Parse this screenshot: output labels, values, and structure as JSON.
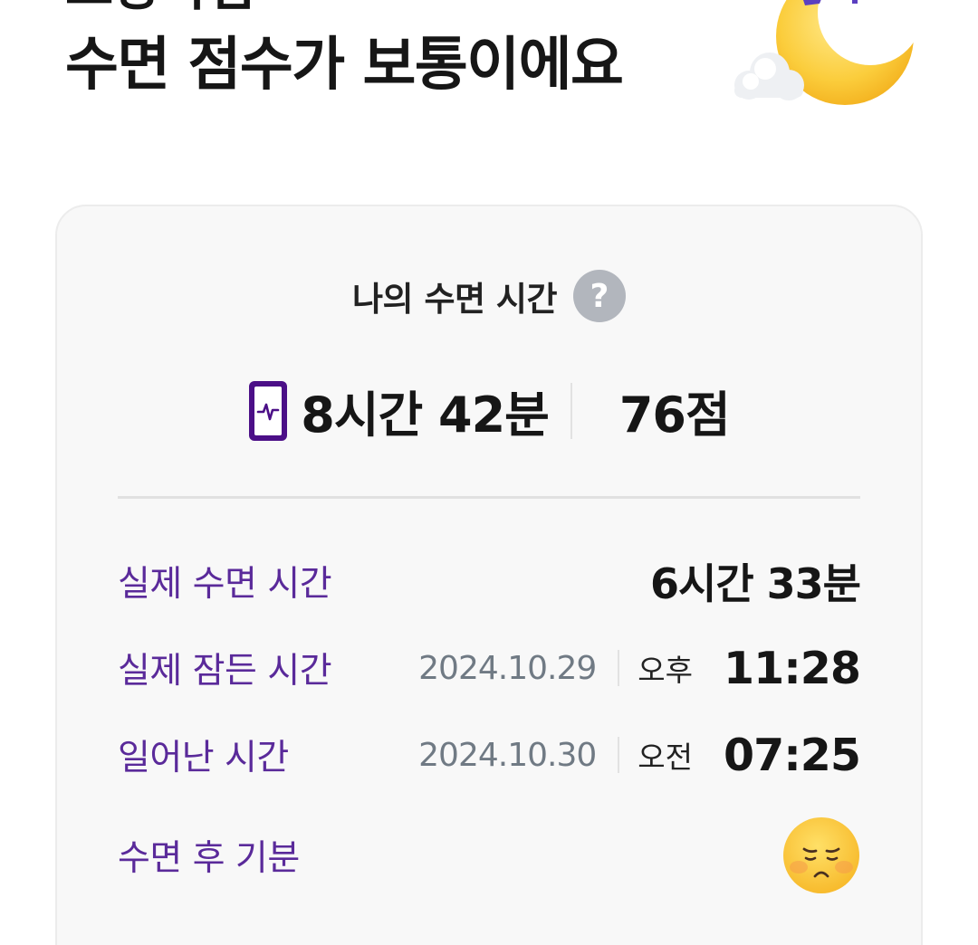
{
  "header": {
    "line1": "고양파입",
    "line2": "수면 점수가 보통이에요"
  },
  "card": {
    "title": "나의 수면 시간",
    "help_icon": "question-circle-icon",
    "help_glyph": "?",
    "total_time": "8시간 42분",
    "score": "76점",
    "rows": [
      {
        "label": "실제 수면 시간",
        "value": "6시간 33분"
      },
      {
        "label": "실제 잠든 시간",
        "date": "2024.10.29",
        "ampm": "오후",
        "time": "11:28"
      },
      {
        "label": "일어난 시간",
        "date": "2024.10.30",
        "ampm": "오전",
        "time": "07:25"
      },
      {
        "label": "수면 후 기분",
        "mood_icon": "tired-face-emoji-icon"
      }
    ]
  },
  "colors": {
    "accent_purple": "#5a2a9a",
    "device_icon_purple": "#4b0f87",
    "help_gray": "#b2b6bd",
    "card_bg": "#f8f8f8"
  }
}
